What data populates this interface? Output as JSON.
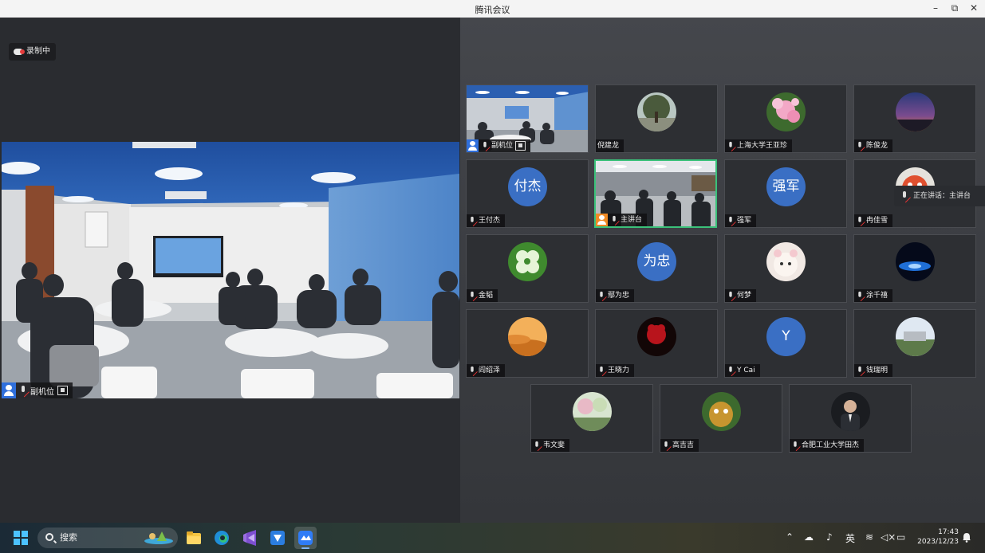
{
  "window": {
    "title": "腾讯会议",
    "controls": {
      "minimize": "–",
      "maximize": "⧉",
      "close": "✕"
    }
  },
  "main": {
    "recording_label": "录制中",
    "speaker_name": "副机位"
  },
  "speaking_indicator": "正在讲话：主讲台",
  "participants": [
    {
      "name": "副机位",
      "type": "video"
    },
    {
      "name": "倪建龙",
      "type": "photo"
    },
    {
      "name": "上海大学王亚珍",
      "type": "photo"
    },
    {
      "name": "陈俊龙",
      "type": "photo"
    },
    {
      "name": "王付杰",
      "type": "text",
      "avatar_text": "付杰"
    },
    {
      "name": "主讲台",
      "type": "video",
      "active": true
    },
    {
      "name": "强军",
      "type": "text",
      "avatar_text": "强军"
    },
    {
      "name": "冉佳雪",
      "type": "photo"
    },
    {
      "name": "金韬",
      "type": "photo"
    },
    {
      "name": "鄢为忠",
      "type": "text",
      "avatar_text": "为忠"
    },
    {
      "name": "何梦",
      "type": "photo"
    },
    {
      "name": "涂千禧",
      "type": "photo"
    },
    {
      "name": "阎绍泽",
      "type": "photo"
    },
    {
      "name": "王晓力",
      "type": "photo"
    },
    {
      "name": "Y Cai",
      "type": "text",
      "avatar_text": "Y"
    },
    {
      "name": "钱瑞明",
      "type": "photo"
    },
    {
      "name": "韦文斐",
      "type": "photo"
    },
    {
      "name": "高吉吉",
      "type": "photo"
    },
    {
      "name": "合肥工业大学田杰",
      "type": "photo"
    }
  ],
  "taskbar": {
    "search_label": "搜索",
    "ime_label": "英",
    "time": "17:43",
    "date": "2023/12/23"
  },
  "colors": {
    "accent_green": "#3bc17a",
    "avatar_blue": "#3a6fc4",
    "badge_blue": "#2f6fdc",
    "recording_red": "#e43c3c"
  }
}
